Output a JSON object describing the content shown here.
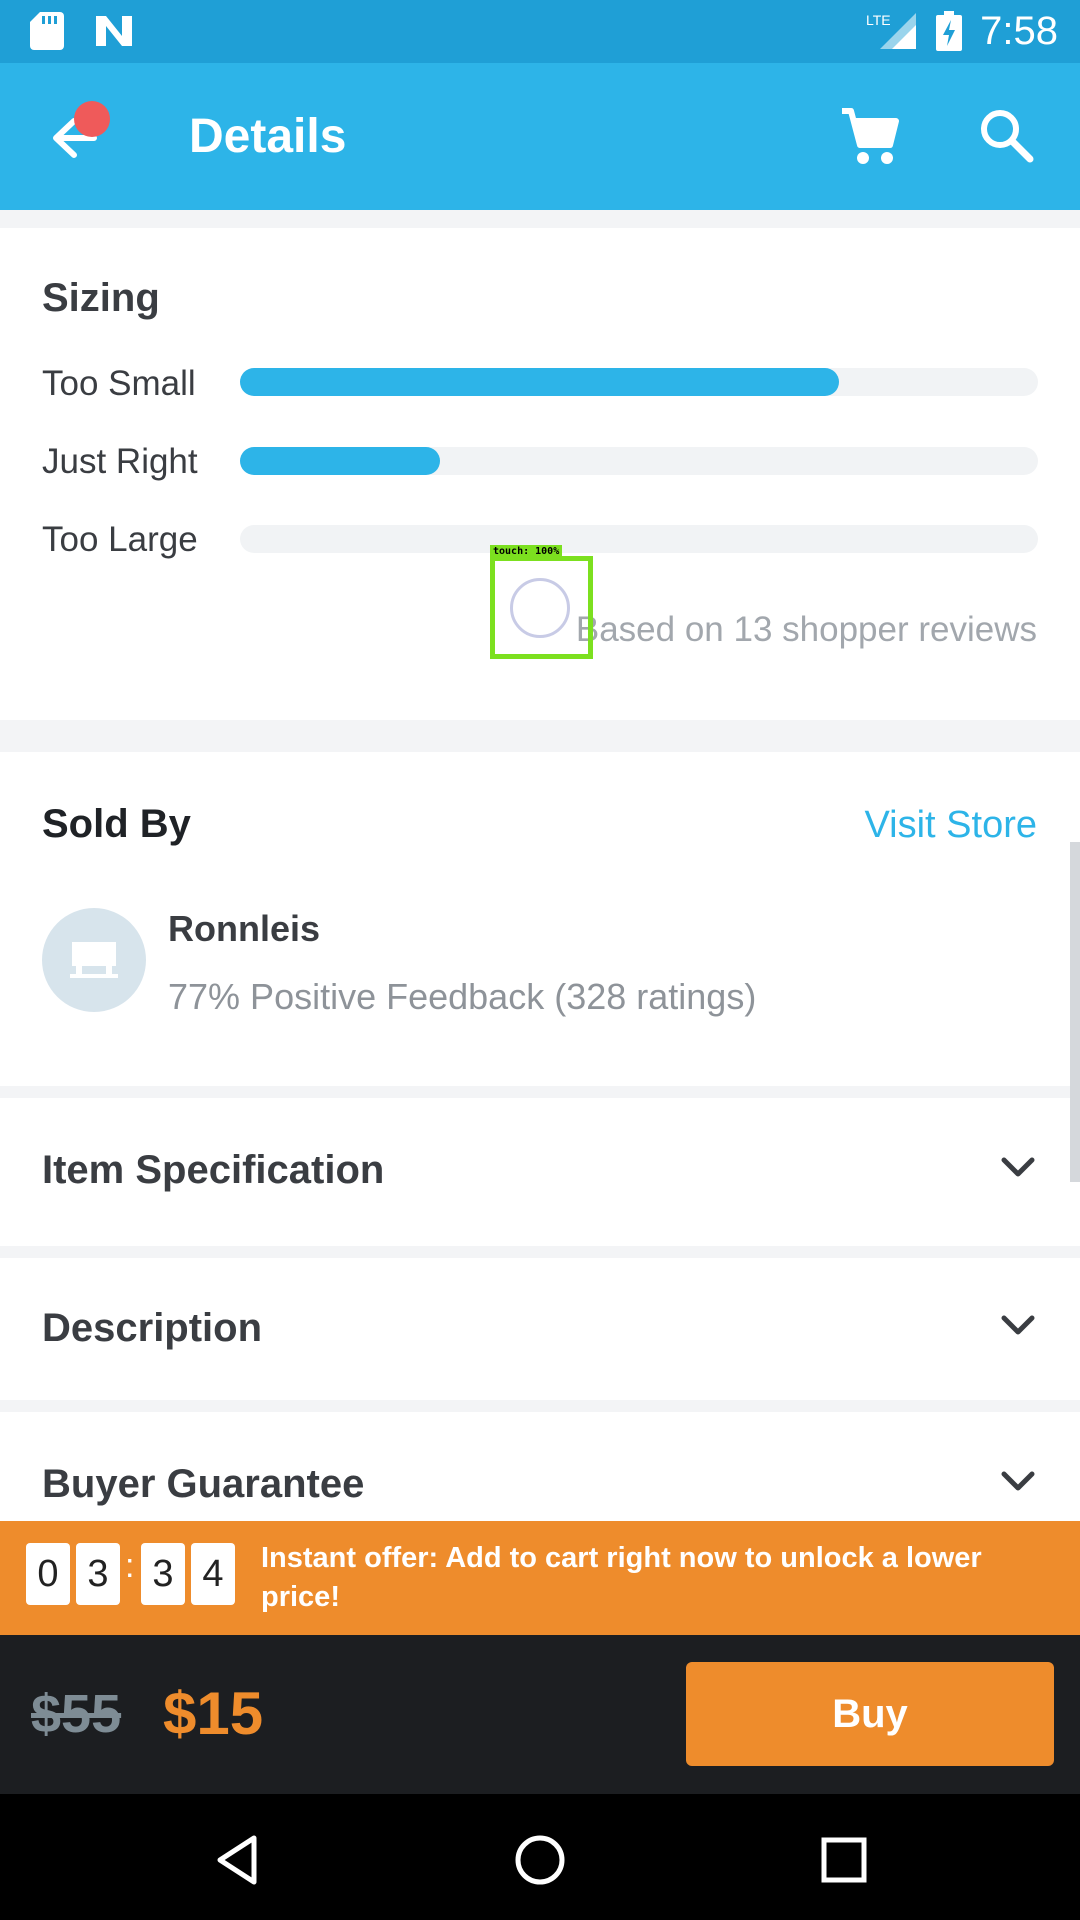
{
  "status_bar": {
    "network": "LTE",
    "time": "7:58"
  },
  "app_bar": {
    "title": "Details"
  },
  "sizing": {
    "title": "Sizing",
    "rows": [
      {
        "label": "Too Small",
        "fraction": 0.75
      },
      {
        "label": "Just Right",
        "fraction": 0.25
      },
      {
        "label": "Too Large",
        "fraction": 0
      }
    ],
    "note": "Based on 13 shopper reviews"
  },
  "touch_overlay": {
    "label": "touch: 100%"
  },
  "sold_by": {
    "title": "Sold By",
    "visit_store": "Visit Store",
    "store_name": "Ronnleis",
    "feedback": "77% Positive Feedback (328 ratings)"
  },
  "accordions": [
    {
      "label": "Item Specification"
    },
    {
      "label": "Description"
    },
    {
      "label": "Buyer Guarantee"
    }
  ],
  "offer": {
    "countdown": [
      "0",
      "3",
      "3",
      "4"
    ],
    "separator": ":",
    "text": "Instant offer: Add to cart right now to unlock a lower price!"
  },
  "buy_bar": {
    "old_price": "$55",
    "price": "$15",
    "buy_label": "Buy"
  },
  "colors": {
    "accent": "#2db4e8",
    "offer": "#ee8c2c",
    "status_bar": "#1f9fd6"
  },
  "icons": [
    "sd-card-icon",
    "n-icon",
    "signal-icon",
    "battery-icon",
    "back-arrow-icon",
    "cart-icon",
    "search-icon",
    "store-icon",
    "chevron-down-icon",
    "nav-back-icon",
    "nav-home-icon",
    "nav-recents-icon"
  ]
}
